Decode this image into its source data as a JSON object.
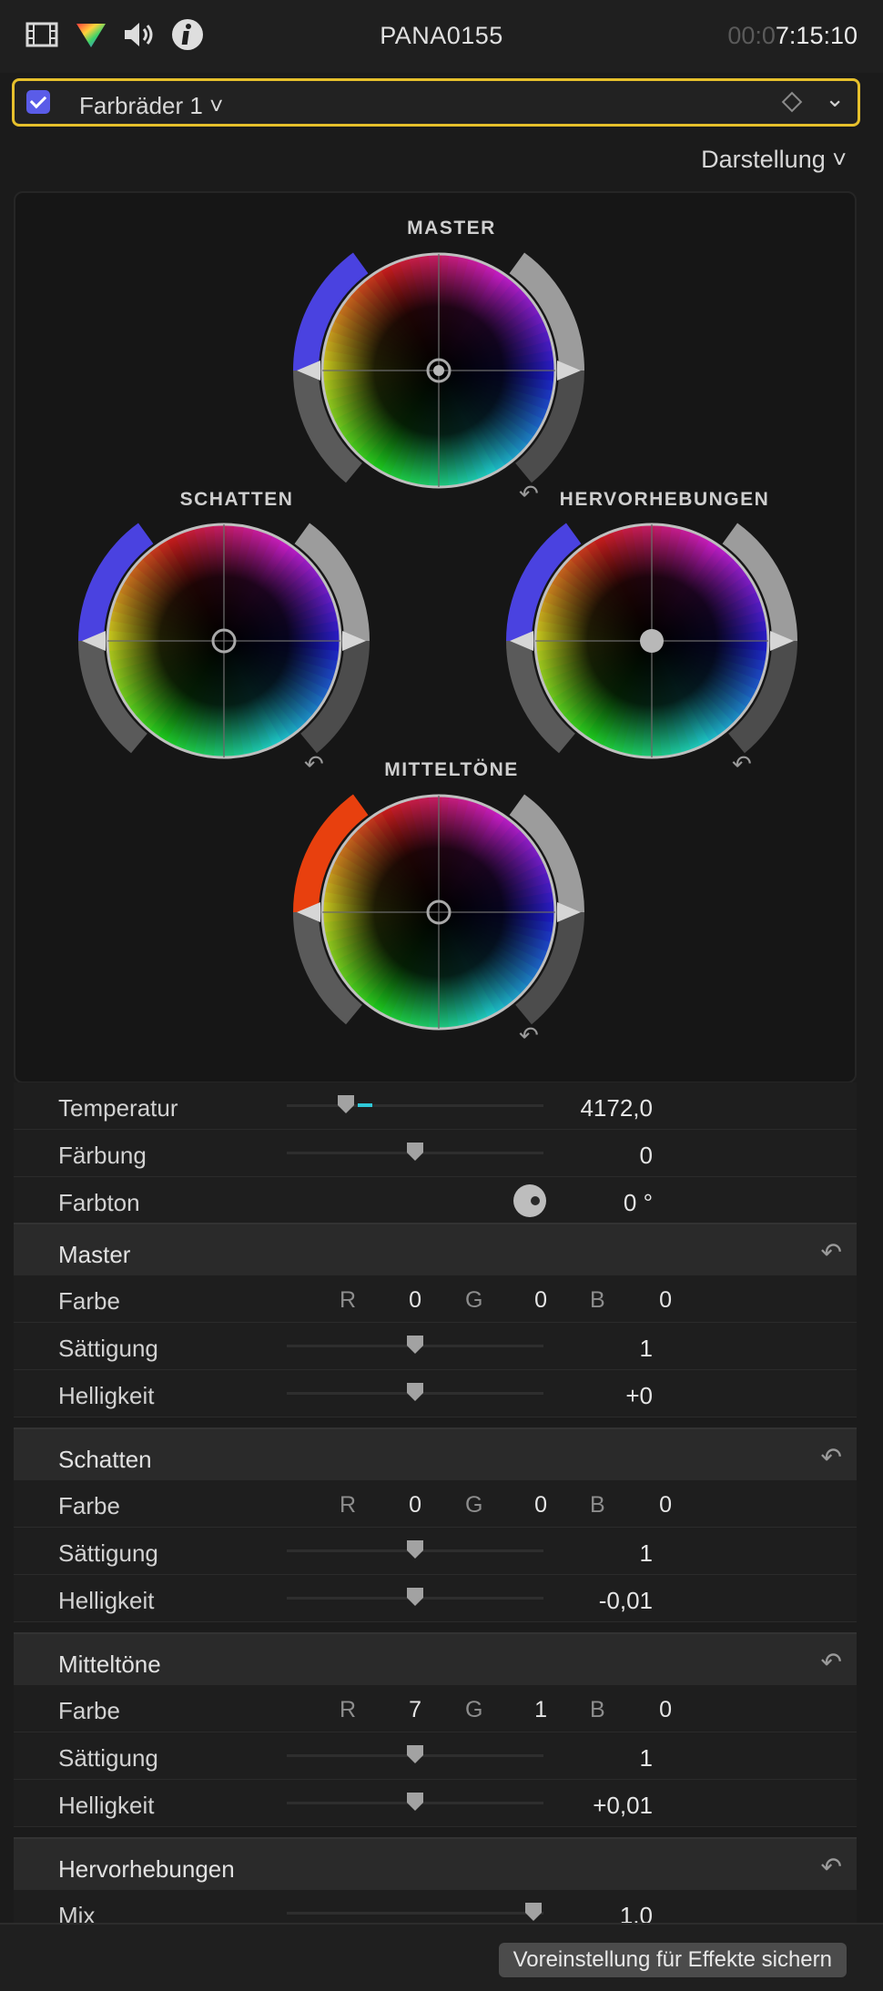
{
  "header": {
    "clip_name": "PANA0155",
    "timecode_dim": "00:0",
    "timecode": "7:15:10",
    "icons": [
      "film-icon",
      "color-prism-icon",
      "speaker-icon",
      "info-icon"
    ]
  },
  "effect": {
    "checked": true,
    "name": "Farbräder 1 ˅",
    "caret": "⌄"
  },
  "view_menu": {
    "label": "Darstellung ˅"
  },
  "wheels": {
    "master": "MASTER",
    "shadows": "SCHATTEN",
    "highlights": "HERVORHEBUNGEN",
    "midtones": "MITTELTÖNE"
  },
  "params": {
    "temperature": {
      "label": "Temperatur",
      "value": "4172,0"
    },
    "tint": {
      "label": "Färbung",
      "value": "0"
    },
    "hue": {
      "label": "Farbton",
      "value": "0 °"
    }
  },
  "sections": [
    {
      "title": "Master",
      "color": {
        "label": "Farbe",
        "r": "0",
        "g": "0",
        "b": "0"
      },
      "saturation": {
        "label": "Sättigung",
        "value": "1"
      },
      "brightness": {
        "label": "Helligkeit",
        "value": "+0"
      }
    },
    {
      "title": "Schatten",
      "color": {
        "label": "Farbe",
        "r": "0",
        "g": "0",
        "b": "0"
      },
      "saturation": {
        "label": "Sättigung",
        "value": "1"
      },
      "brightness": {
        "label": "Helligkeit",
        "value": "-0,01"
      }
    },
    {
      "title": "Mitteltöne",
      "color": {
        "label": "Farbe",
        "r": "7",
        "g": "1",
        "b": "0"
      },
      "saturation": {
        "label": "Sättigung",
        "value": "1"
      },
      "brightness": {
        "label": "Helligkeit",
        "value": "+0,01"
      }
    },
    {
      "title": "Hervorhebungen",
      "mix": {
        "label": "Mix",
        "value": "1,0"
      }
    }
  ],
  "rgb_labels": {
    "r": "R",
    "g": "G",
    "b": "B"
  },
  "save_button": "Voreinstellung für Effekte sichern",
  "colors": {
    "accent_outline": "#e6c02c",
    "checkbox": "#5a5ce8",
    "temperature_marker": "#2fc8d8"
  }
}
